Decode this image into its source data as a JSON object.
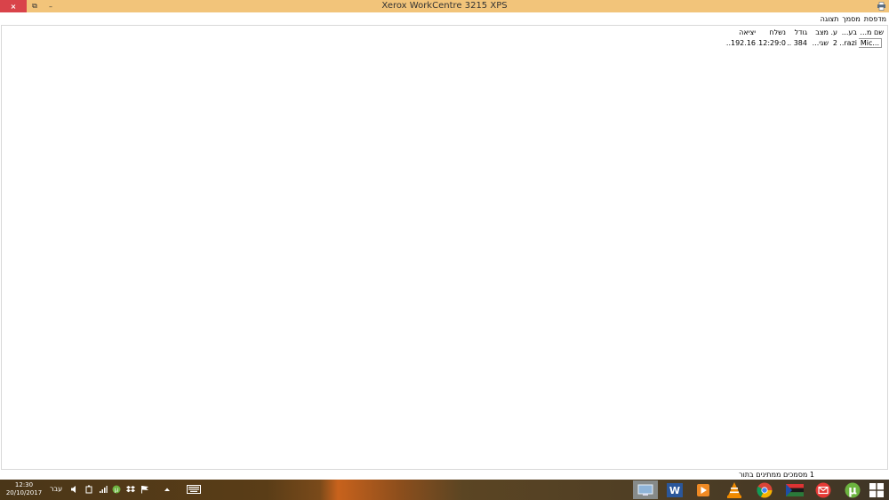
{
  "window": {
    "title": "Xerox WorkCentre 3215 XPS",
    "close_glyph": "×",
    "restore_glyph": "⧉",
    "minimize_glyph": "–"
  },
  "menu": {
    "items": [
      "מדפסת",
      "מסמך",
      "תצוגה"
    ]
  },
  "columns": [
    "שם מ...",
    "בע...",
    "ע...",
    "מצב",
    "גודל",
    "נשלח",
    "יציאה"
  ],
  "rows": [
    {
      "name": "Mic...",
      "owner": "razi...",
      "pages": "2",
      "status": "שגי...",
      "size": "384 ...",
      "submitted": "12:29:0...",
      "port": "192.16..."
    }
  ],
  "status": {
    "text": "1 מסמכים ממתינים בתור"
  },
  "taskbar": {
    "time": "12:30",
    "date": "20/10/2017",
    "language": "עבר",
    "icons": [
      "windows-start-icon",
      "utorrent-icon",
      "mail-icon",
      "language-bar-icon",
      "chrome-icon",
      "vlc-icon",
      "media-player-icon",
      "word-icon",
      "network-desktop-icon",
      "keyboard-icon"
    ],
    "colors": {
      "word": "#2b579a",
      "chrome_red": "#db4437",
      "chrome_green": "#0f9d58",
      "chrome_yellow": "#f4b400",
      "utorrent": "#6cb33f",
      "vlc": "#f08a00",
      "mail": "#e53935"
    }
  },
  "colors": {
    "titlebar": "#f2c47a",
    "close_button": "#d9434a"
  }
}
